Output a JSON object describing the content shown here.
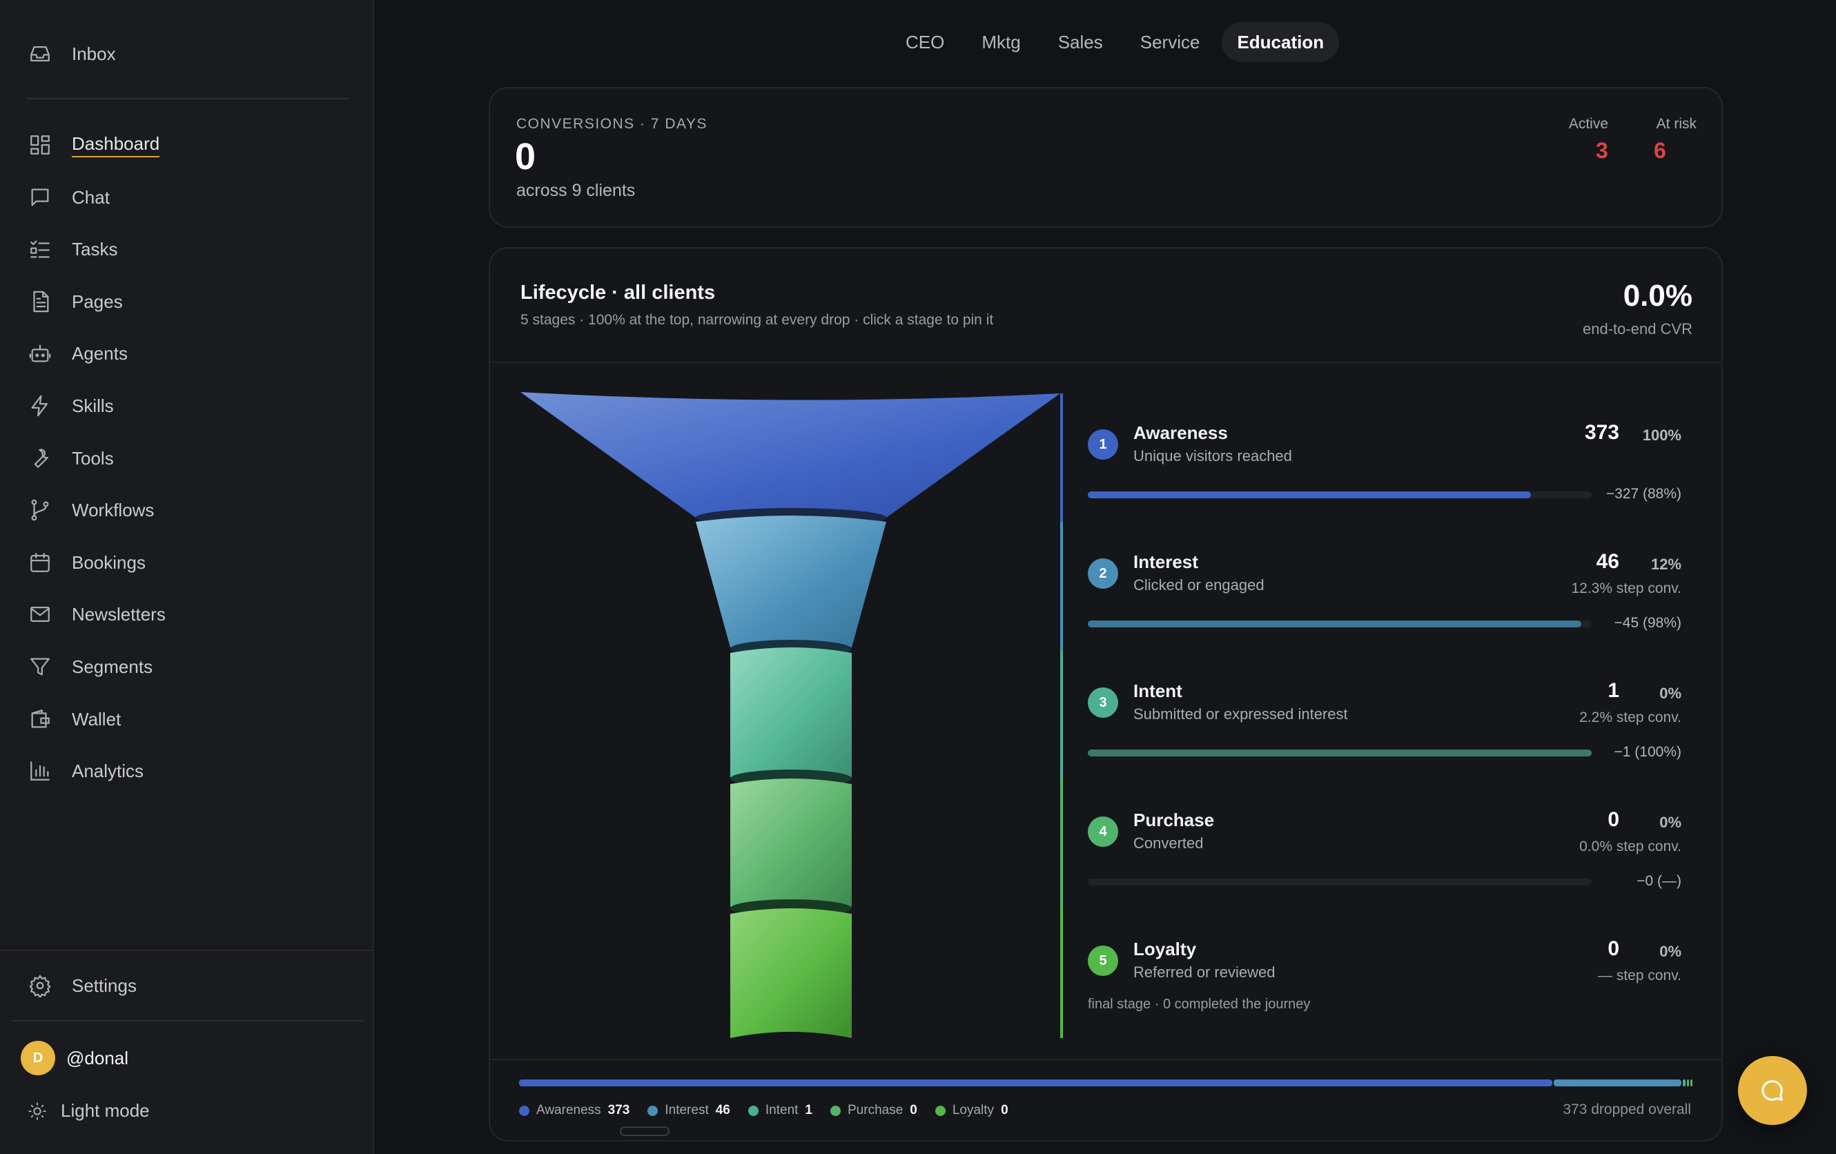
{
  "sidebar": {
    "inbox": "Inbox",
    "items": [
      {
        "label": "Dashboard",
        "icon": "dashboard-icon"
      },
      {
        "label": "Chat",
        "icon": "chat-icon"
      },
      {
        "label": "Tasks",
        "icon": "tasks-icon"
      },
      {
        "label": "Pages",
        "icon": "page-icon"
      },
      {
        "label": "Agents",
        "icon": "robot-icon"
      },
      {
        "label": "Skills",
        "icon": "bolt-icon"
      },
      {
        "label": "Tools",
        "icon": "wrench-icon"
      },
      {
        "label": "Workflows",
        "icon": "git-branch-icon"
      },
      {
        "label": "Bookings",
        "icon": "calendar-icon"
      },
      {
        "label": "Newsletters",
        "icon": "mail-icon"
      },
      {
        "label": "Segments",
        "icon": "filter-icon"
      },
      {
        "label": "Wallet",
        "icon": "wallet-icon"
      },
      {
        "label": "Analytics",
        "icon": "bar-chart-icon"
      }
    ],
    "active": "Dashboard",
    "settings": "Settings",
    "user": {
      "initial": "D",
      "handle": "@donal"
    },
    "theme_toggle": "Light mode"
  },
  "tabs": [
    {
      "label": "CEO",
      "active": false
    },
    {
      "label": "Mktg",
      "active": false
    },
    {
      "label": "Sales",
      "active": false
    },
    {
      "label": "Service",
      "active": false
    },
    {
      "label": "Education",
      "active": true
    }
  ],
  "summary": {
    "heading": "CONVERSIONS · 7 DAYS",
    "value": "0",
    "sub": "across 9 clients",
    "active_label": "Active",
    "active_value": "3",
    "risk_label": "At risk",
    "risk_value": "6",
    "alert_color": "#e0443e"
  },
  "lifecycle": {
    "title": "Lifecycle · all clients",
    "subtitle": "5 stages · 100% at the top, narrowing at every drop · click a stage to pin it",
    "cvr": "0.0%",
    "cvr_label": "end-to-end CVR",
    "stages": [
      {
        "num": "1",
        "name": "Awareness",
        "desc": "Unique visitors reached",
        "value": "373",
        "pct": "100%",
        "conv": "",
        "drop": "−327 (88%)",
        "bar": 0.88,
        "color": "#3f63c4"
      },
      {
        "num": "2",
        "name": "Interest",
        "desc": "Clicked or engaged",
        "value": "46",
        "pct": "12%",
        "conv": "12.3% step conv.",
        "drop": "−45 (98%)",
        "bar": 0.98,
        "color": "#4a8fb8"
      },
      {
        "num": "3",
        "name": "Intent",
        "desc": "Submitted or expressed interest",
        "value": "1",
        "pct": "0%",
        "conv": "2.2% step conv.",
        "drop": "−1 (100%)",
        "bar": 1.0,
        "color": "#4cae92"
      },
      {
        "num": "4",
        "name": "Purchase",
        "desc": "Converted",
        "value": "0",
        "pct": "0%",
        "conv": "0.0% step conv.",
        "drop": "−0 (—)",
        "bar": 0,
        "color": "#52b56c"
      },
      {
        "num": "5",
        "name": "Loyalty",
        "desc": "Referred or reviewed",
        "value": "0",
        "pct": "0%",
        "conv": "— step conv.",
        "drop": "",
        "bar": 0,
        "color": "#55b84a"
      }
    ],
    "final_note": "final stage · 0 completed the journey",
    "legend": [
      {
        "name": "Awareness",
        "value": "373",
        "color": "#3f63c4"
      },
      {
        "name": "Interest",
        "value": "46",
        "color": "#4a8fb8"
      },
      {
        "name": "Intent",
        "value": "1",
        "color": "#4cae92"
      },
      {
        "name": "Purchase",
        "value": "0",
        "color": "#52b56c"
      },
      {
        "name": "Loyalty",
        "value": "0",
        "color": "#55b84a"
      }
    ],
    "dropped_overall": "373 dropped overall"
  }
}
